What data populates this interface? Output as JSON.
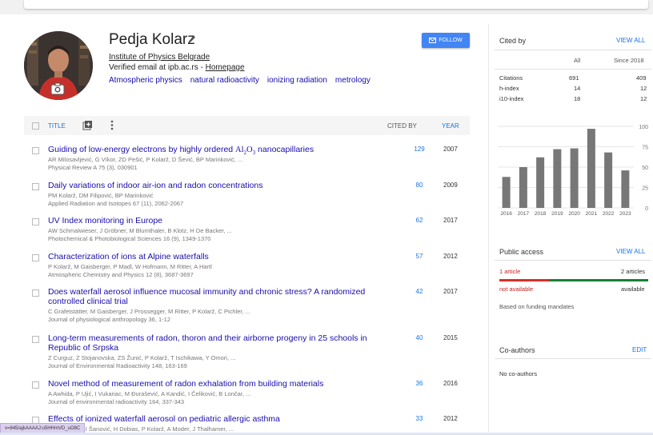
{
  "profile": {
    "name": "Pedja Kolarz",
    "affiliation": "Institute of Physics Belgrade",
    "verified": "Verified email at ipb.ac.rs - ",
    "homepage": "Homepage",
    "interests": [
      "Atmospheric physics",
      "natural radioactivity",
      "ionizing radiation",
      "metrology"
    ],
    "follow_label": "FOLLOW"
  },
  "table": {
    "title_label": "TITLE",
    "cited_by_label": "CITED BY",
    "year_label": "YEAR"
  },
  "articles": [
    {
      "title_pre": "Guiding of low-energy electrons by highly ordered ",
      "title_formula": "Al",
      "sub1": "2",
      "mid": "O",
      "sub2": "3",
      "title_post": " nanocapillaries",
      "authors": "AR Milosavljević, G Víkor, ZD Pešić, P Kolarž, D Šević, BP Marinković, ...",
      "journal": "Physical Review A 75 (3), 030901",
      "cited": "129",
      "year": "2007"
    },
    {
      "title": "Daily variations of indoor air-ion and radon concentrations",
      "authors": "PM Kolarž, DM Filipović, BP Marinković",
      "journal": "Applied Radiation and Isotopes 67 (11), 2062-2067",
      "cited": "80",
      "year": "2009"
    },
    {
      "title": "UV Index monitoring in Europe",
      "authors": "AW Schmalwieser, J Gröbner, M Blumthaler, B Klotz, H De Backer, ...",
      "journal": "Photochemical & Photobiological Sciences 16 (9), 1349-1370",
      "cited": "62",
      "year": "2017"
    },
    {
      "title": "Characterization of ions at Alpine waterfalls",
      "authors": "P Kolarž, M Gaisberger, P Madl, W Hofmann, M Ritter, A Hartl",
      "journal": "Atmospheric Chemistry and Physics 12 (8), 3687-3697",
      "cited": "57",
      "year": "2012"
    },
    {
      "title": "Does waterfall aerosol influence mucosal immunity and chronic stress? A randomized controlled clinical trial",
      "authors": "C Grafetstätter, M Gaisberger, J Prossegger, M Ritter, P Kolarž, C Pichler, ...",
      "journal": "Journal of physiological anthropology 36, 1-12",
      "cited": "42",
      "year": "2017"
    },
    {
      "title": "Long-term measurements of radon, thoron and their airborne progeny in 25 schools in Republic of Srpska",
      "authors": "Z Curguz, Z Stojanovska, ZS Žunić, P Kolarž, T Ischikawa, Y Omori, ...",
      "journal": "Journal of Environmental Radioactivity 148, 163-169",
      "cited": "40",
      "year": "2015"
    },
    {
      "title": "Novel method of measurement of radon exhalation from building materials",
      "authors": "A Awhida, P Ujić, I Vukanac, M Đurašević, A Kandić, I Čeliković, B Lončar, ...",
      "journal": "Journal of environmental radioactivity 164, 337-343",
      "cited": "36",
      "year": "2016"
    },
    {
      "title": "Effects of ionized waterfall aerosol on pediatric allergic asthma",
      "authors": "J Gaisberger, I Šanović, H Dobias, P Kolarž, A Moder, J Thalhamer, ...",
      "journal": "",
      "cited": "33",
      "year": "2012"
    }
  ],
  "cited_by": {
    "title": "Cited by",
    "view_all": "VIEW ALL",
    "col_all": "All",
    "col_since": "Since 2018",
    "rows": [
      {
        "label": "Citations",
        "all": "691",
        "since": "409"
      },
      {
        "label": "h-index",
        "all": "14",
        "since": "12"
      },
      {
        "label": "i10-index",
        "all": "18",
        "since": "12"
      }
    ]
  },
  "chart_data": {
    "type": "bar",
    "categories": [
      "2016",
      "2017",
      "2018",
      "2019",
      "2020",
      "2021",
      "2022",
      "2023"
    ],
    "values": [
      38,
      50,
      62,
      72,
      73,
      97,
      68,
      46
    ],
    "ylim": [
      0,
      100
    ],
    "yticks": [
      "0",
      "25",
      "50",
      "75",
      "100"
    ],
    "bar_color": "#777777"
  },
  "public_access": {
    "title": "Public access",
    "view_all": "VIEW ALL",
    "left_count": "1 article",
    "right_count": "2 articles",
    "left_status": "not available",
    "right_status": "available",
    "note": "Based on funding mandates"
  },
  "coauthors": {
    "title": "Co-authors",
    "edit": "EDIT",
    "none": "No co-authors"
  },
  "status_url": "v=845/ajkAAAAJ:u5HHmVD_uO8C"
}
